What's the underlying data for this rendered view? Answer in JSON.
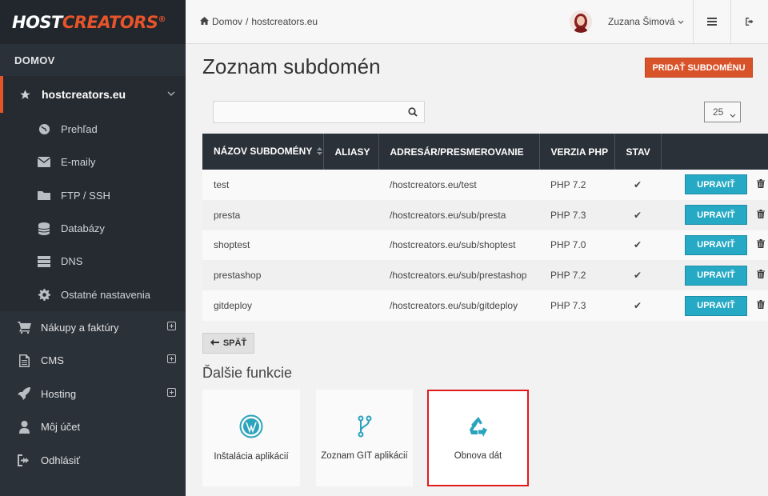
{
  "logo": {
    "host": "HOST",
    "creators": "CREATORS",
    "reg": "®"
  },
  "sidebar": {
    "section": "DOMOV",
    "active_domain": "hostcreators.eu",
    "sub_items": [
      {
        "label": "Prehľad",
        "icon": "globe-icon"
      },
      {
        "label": "E-maily",
        "icon": "envelope-icon"
      },
      {
        "label": "FTP / SSH",
        "icon": "folder-icon"
      },
      {
        "label": "Databázy",
        "icon": "database-icon"
      },
      {
        "label": "DNS",
        "icon": "server-icon"
      },
      {
        "label": "Ostatné nastavenia",
        "icon": "gear-icon"
      }
    ],
    "main_items": [
      {
        "label": "Nákupy a faktúry",
        "icon": "cart-icon",
        "expandable": true
      },
      {
        "label": "CMS",
        "icon": "document-icon",
        "expandable": true
      },
      {
        "label": "Hosting",
        "icon": "rocket-icon",
        "expandable": true
      },
      {
        "label": "Môj účet",
        "icon": "user-icon",
        "expandable": false
      },
      {
        "label": "Odhlásiť",
        "icon": "logout-icon",
        "expandable": false
      }
    ]
  },
  "topbar": {
    "breadcrumb_home": "Domov",
    "breadcrumb_sep": "/",
    "breadcrumb_current": "hostcreators.eu",
    "user_name": "Zuzana Šimová"
  },
  "main": {
    "title": "Zoznam subdomén",
    "add_button": "PRIDAŤ SUBDOMÉNU",
    "search": {
      "value": "",
      "placeholder": ""
    },
    "page_size": "25",
    "table": {
      "headers": [
        "NÁZOV SUBDOMÉNY",
        "ALIASY",
        "ADRESÁR/PRESMEROVANIE",
        "VERZIA PHP",
        "STAV",
        ""
      ],
      "rows": [
        {
          "name": "test",
          "aliases": "",
          "dir": "/hostcreators.eu/test",
          "php": "PHP 7.2",
          "status": "✔",
          "edit": "UPRAVIŤ"
        },
        {
          "name": "presta",
          "aliases": "",
          "dir": "/hostcreators.eu/sub/presta",
          "php": "PHP 7.3",
          "status": "✔",
          "edit": "UPRAVIŤ"
        },
        {
          "name": "shoptest",
          "aliases": "",
          "dir": "/hostcreators.eu/sub/shoptest",
          "php": "PHP 7.0",
          "status": "✔",
          "edit": "UPRAVIŤ"
        },
        {
          "name": "prestashop",
          "aliases": "",
          "dir": "/hostcreators.eu/sub/prestashop",
          "php": "PHP 7.2",
          "status": "✔",
          "edit": "UPRAVIŤ"
        },
        {
          "name": "gitdeploy",
          "aliases": "",
          "dir": "/hostcreators.eu/sub/gitdeploy",
          "php": "PHP 7.3",
          "status": "✔",
          "edit": "UPRAVIŤ"
        }
      ]
    },
    "back_button": "SPÄŤ",
    "more_title": "Ďalšie funkcie",
    "cards": [
      {
        "label": "Inštalácia aplikácií",
        "icon": "wordpress-icon",
        "selected": false
      },
      {
        "label": "Zoznam GIT aplikácií",
        "icon": "git-branch-icon",
        "selected": false
      },
      {
        "label": "Obnova dát",
        "icon": "recycle-icon",
        "selected": true
      }
    ]
  },
  "colors": {
    "accent": "#e8542a",
    "sidebar": "#2b3138",
    "edit": "#26a9c4",
    "highlight": "#e11b1b"
  }
}
